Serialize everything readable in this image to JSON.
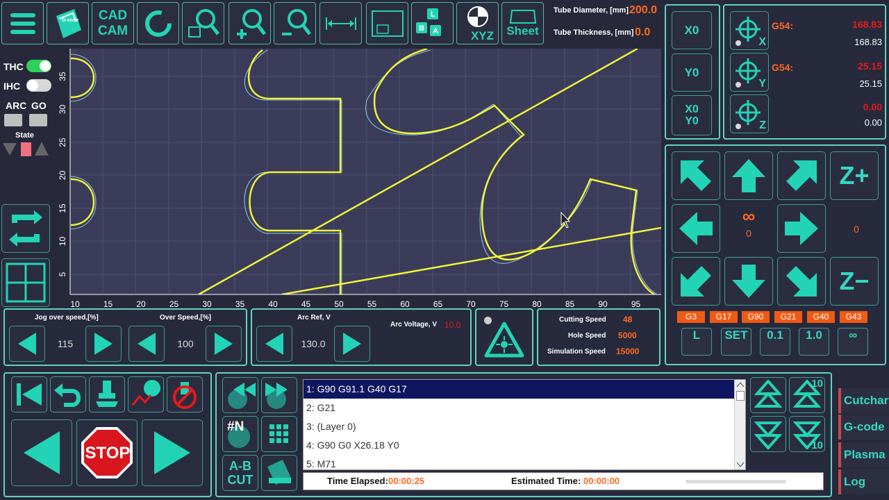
{
  "toolbar": {
    "menu_icon": "hamburger-icon",
    "gcode_label": "G-code",
    "cadcam_line1": "CAD",
    "cadcam_line2": "CAM",
    "xyz_label": "XYZ",
    "sheet_label": "Sheet",
    "ab_keys": [
      "L",
      "B",
      "A"
    ]
  },
  "tube": {
    "diameter_label": "Tube Diameter, [mm]",
    "diameter_value": "200.0",
    "thickness_label": "Tube Thickness, [mm]",
    "thickness_value": "0.0"
  },
  "left_controls": {
    "thc_label": "THC",
    "ihc_label": "IHC",
    "arc_label": "ARC",
    "go_label": "GO",
    "state_label": "State"
  },
  "plot": {
    "x_ticks": [
      "10",
      "15",
      "20",
      "25",
      "30",
      "35",
      "40",
      "45",
      "50",
      "55",
      "60",
      "65",
      "70",
      "75",
      "80",
      "85",
      "90",
      "95"
    ],
    "y_ticks": [
      "35",
      "30",
      "25",
      "20",
      "15",
      "10",
      "5"
    ]
  },
  "zero": {
    "x0": "X0",
    "y0": "Y0",
    "x0y0_line1": "X0",
    "x0y0_line2": "Y0"
  },
  "coords": {
    "g54_label": "G54:",
    "x_label": "X",
    "y_label": "Y",
    "z_label": "Z",
    "x_red": "168.83",
    "x_value": "168.83",
    "y_red": "25.15",
    "y_value": "25.15",
    "z_red": "0.00",
    "z_value": "0.00"
  },
  "jog": {
    "infinity": "∞",
    "center_value": "0",
    "right_value": "0",
    "zplus": "Z+",
    "zminus": "Z−"
  },
  "gcodes_active": [
    "G3",
    "G17",
    "G90",
    "G21",
    "G40",
    "G43"
  ],
  "step_buttons": [
    "L",
    "SET",
    "0.1",
    "1.0",
    "∞"
  ],
  "speeds": {
    "jog_label": "Jog over speed,[%]",
    "jog_value": "115",
    "over_label": "Over Speed,[%]",
    "over_value": "100",
    "arcref_label": "Arc Ref, V",
    "arcref_value": "130.0",
    "arcvolt_label": "Arc Voltage, V",
    "arcvolt_value": "10.0",
    "cutting_label": "Cutting Speed",
    "cutting_value": "48",
    "hole_label": "Hole Speed",
    "hole_value": "5000",
    "sim_label": "Simulation Speed",
    "sim_value": "15000"
  },
  "run": {
    "stop_label": "STOP",
    "n_label": "#N",
    "ab_line1": "A-B",
    "ab_line2": "CUT"
  },
  "gcode_lines": [
    "1: G90 G91.1 G40 G17",
    "2: G21",
    "3: (Layer 0)",
    "4: G90 G0 X26.18 Y0",
    "5: M71"
  ],
  "status": {
    "elapsed_label": "Time Elapsed:",
    "elapsed_value": "00:00:25",
    "estimated_label": "Estimated Time:",
    "estimated_value": "00:00:00"
  },
  "scroll_step": {
    "top": "10",
    "bottom": "10"
  },
  "side_tabs": [
    "Cutchart",
    "G-code",
    "Plasma",
    "Log"
  ],
  "colors": {
    "accent": "#23d3b6",
    "orange": "#ff6a1f",
    "red": "#e8181e",
    "path": "#f2f23a",
    "plot_bg": "#3a3c5a"
  }
}
